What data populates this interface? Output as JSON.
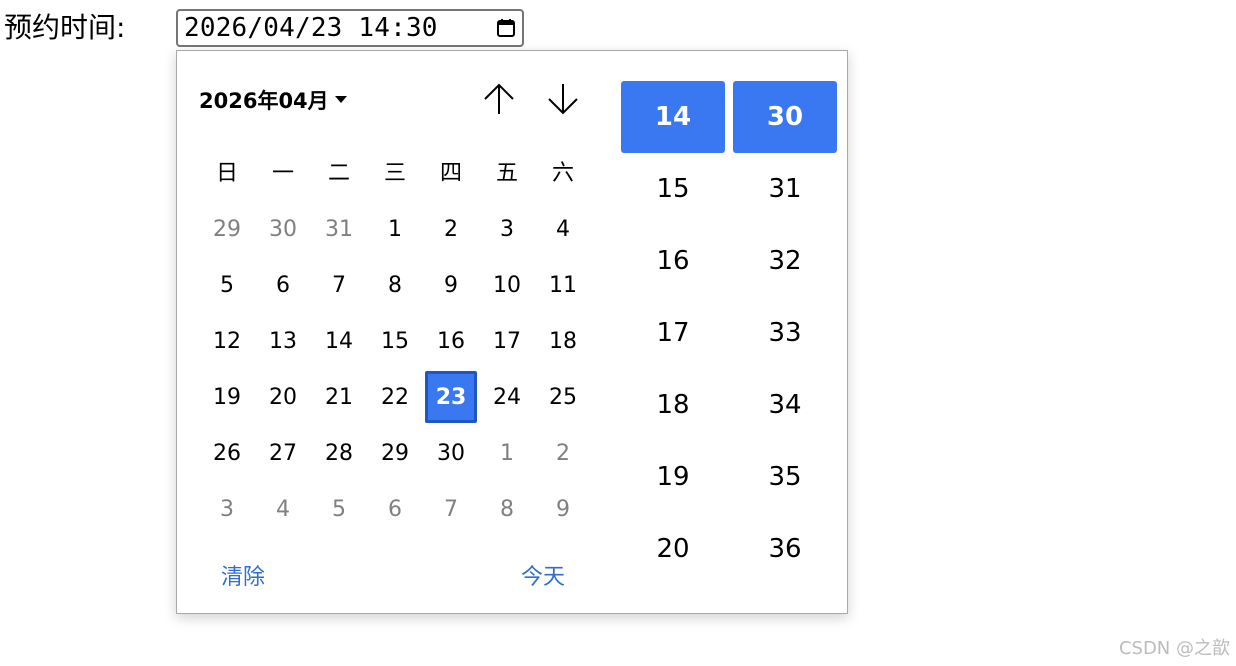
{
  "form": {
    "label": "预约时间:",
    "input_value": "2026/04/23 14:30"
  },
  "picker": {
    "month_label": "2026年04月",
    "weekdays": [
      "日",
      "一",
      "二",
      "三",
      "四",
      "五",
      "六"
    ],
    "days": [
      {
        "label": "29",
        "muted": true
      },
      {
        "label": "30",
        "muted": true
      },
      {
        "label": "31",
        "muted": true
      },
      {
        "label": "1"
      },
      {
        "label": "2"
      },
      {
        "label": "3"
      },
      {
        "label": "4"
      },
      {
        "label": "5"
      },
      {
        "label": "6"
      },
      {
        "label": "7"
      },
      {
        "label": "8"
      },
      {
        "label": "9"
      },
      {
        "label": "10"
      },
      {
        "label": "11"
      },
      {
        "label": "12"
      },
      {
        "label": "13"
      },
      {
        "label": "14"
      },
      {
        "label": "15"
      },
      {
        "label": "16"
      },
      {
        "label": "17"
      },
      {
        "label": "18"
      },
      {
        "label": "19"
      },
      {
        "label": "20"
      },
      {
        "label": "21"
      },
      {
        "label": "22"
      },
      {
        "label": "23",
        "selected": true
      },
      {
        "label": "24"
      },
      {
        "label": "25"
      },
      {
        "label": "26"
      },
      {
        "label": "27"
      },
      {
        "label": "28"
      },
      {
        "label": "29"
      },
      {
        "label": "30"
      },
      {
        "label": "1",
        "muted": true
      },
      {
        "label": "2",
        "muted": true
      },
      {
        "label": "3",
        "muted": true
      },
      {
        "label": "4",
        "muted": true
      },
      {
        "label": "5",
        "muted": true
      },
      {
        "label": "6",
        "muted": true
      },
      {
        "label": "7",
        "muted": true
      },
      {
        "label": "8",
        "muted": true
      },
      {
        "label": "9",
        "muted": true
      }
    ],
    "clear_label": "清除",
    "today_label": "今天",
    "hours": [
      "14",
      "15",
      "16",
      "17",
      "18",
      "19",
      "20"
    ],
    "minutes": [
      "30",
      "31",
      "32",
      "33",
      "34",
      "35",
      "36"
    ],
    "selected_hour": "14",
    "selected_minute": "30",
    "accent_color": "#3a78f2",
    "link_color": "#2f6ecd"
  },
  "watermark": "CSDN @之歆"
}
